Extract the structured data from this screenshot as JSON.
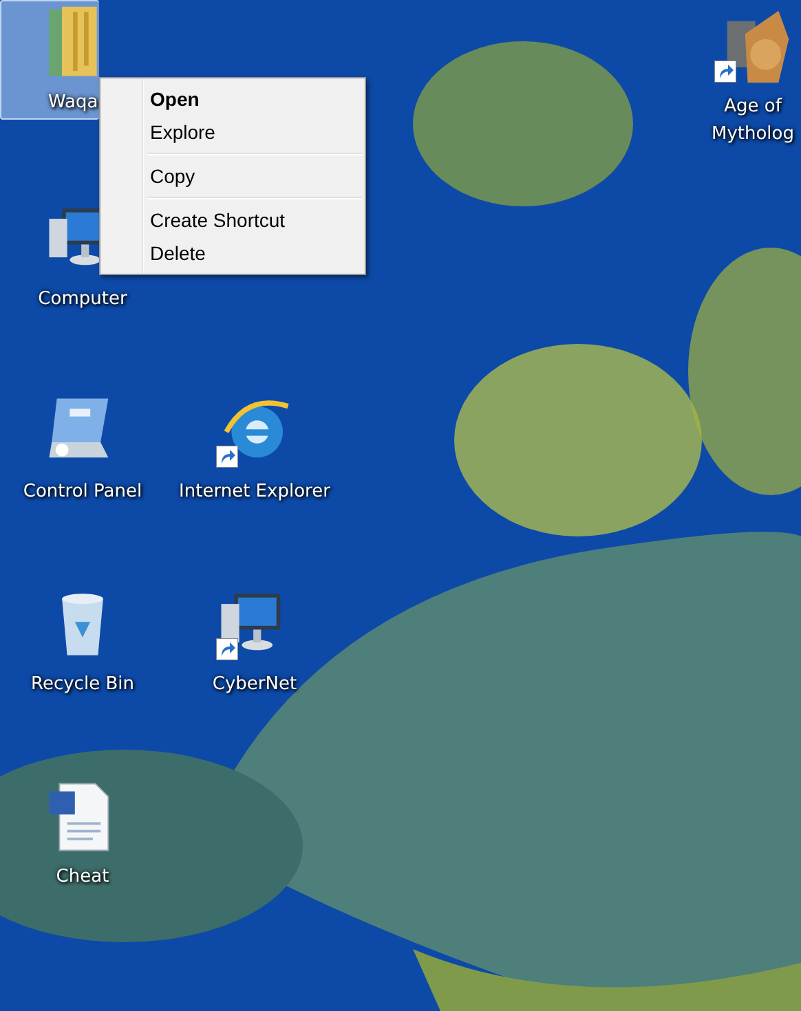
{
  "desktop_icons": [
    {
      "label": "Waqa",
      "kind": "folder",
      "shortcut": false,
      "selected": true
    },
    {
      "label": "Computer",
      "kind": "computer",
      "shortcut": false,
      "selected": false
    },
    {
      "label": "Control Panel",
      "kind": "control-panel",
      "shortcut": false,
      "selected": false
    },
    {
      "label": "Internet Explorer",
      "kind": "browser",
      "shortcut": true,
      "selected": false
    },
    {
      "label": "Recycle Bin",
      "kind": "recycle-bin",
      "shortcut": false,
      "selected": false
    },
    {
      "label": "CyberNet",
      "kind": "computer",
      "shortcut": true,
      "selected": false
    },
    {
      "label": "Cheat",
      "kind": "document",
      "shortcut": false,
      "selected": false
    },
    {
      "label": "Age of Mytholog",
      "kind": "game",
      "shortcut": true,
      "selected": false
    }
  ],
  "context_menu": {
    "groups": [
      [
        {
          "label": "Open",
          "default": true
        },
        {
          "label": "Explore",
          "default": false
        }
      ],
      [
        {
          "label": "Copy",
          "default": false
        }
      ],
      [
        {
          "label": "Create Shortcut",
          "default": false
        },
        {
          "label": "Delete",
          "default": false
        }
      ]
    ]
  }
}
